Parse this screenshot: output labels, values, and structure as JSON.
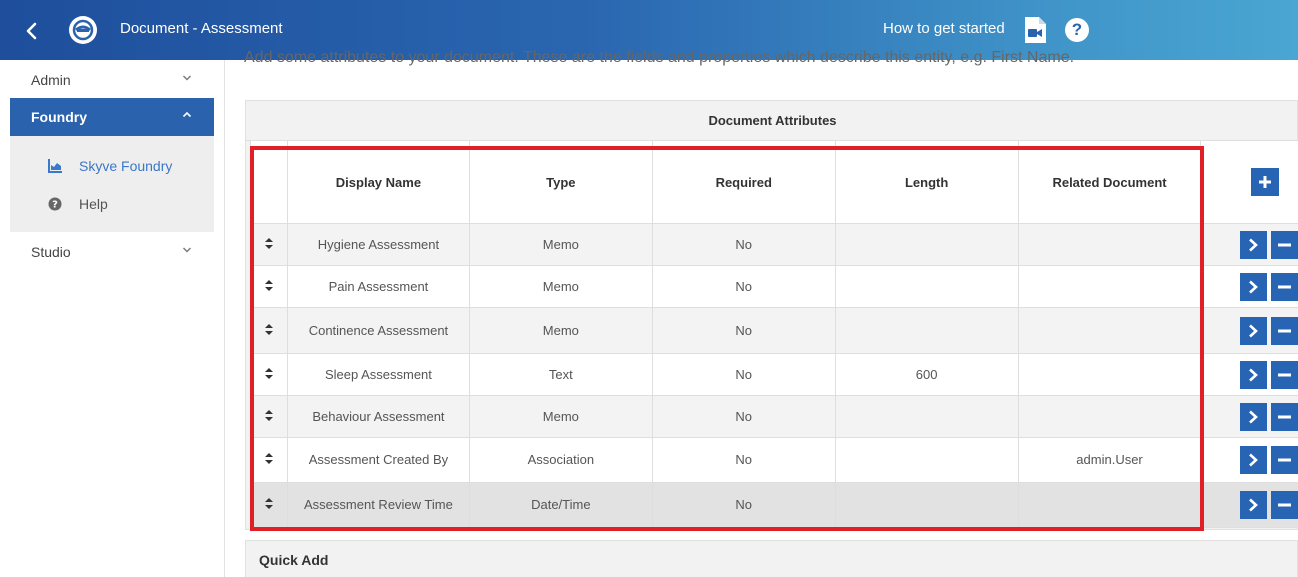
{
  "header": {
    "title": "Document - Assessment",
    "help_link": "How to get started"
  },
  "sidebar": {
    "groups": [
      {
        "label": "Admin"
      },
      {
        "label": "Foundry"
      },
      {
        "label": "Studio"
      }
    ],
    "foundry_items": [
      {
        "label": "Skyve Foundry",
        "icon": "chart-icon"
      },
      {
        "label": "Help",
        "icon": "question-circle-icon"
      }
    ]
  },
  "main": {
    "intro": "Add some attributes to your document. These are the fields and properties which describe this entity, e.g. First Name.",
    "panel_title": "Document Attributes",
    "columns": [
      "Display Name",
      "Type",
      "Required",
      "Length",
      "Related Document"
    ],
    "rows": [
      {
        "display_name": "Hygiene Assessment",
        "type": "Memo",
        "required": "No",
        "length": "",
        "related": ""
      },
      {
        "display_name": "Pain Assessment",
        "type": "Memo",
        "required": "No",
        "length": "",
        "related": ""
      },
      {
        "display_name": "Continence Assessment",
        "type": "Memo",
        "required": "No",
        "length": "",
        "related": ""
      },
      {
        "display_name": "Sleep Assessment",
        "type": "Text",
        "required": "No",
        "length": "600",
        "related": ""
      },
      {
        "display_name": "Behaviour Assessment",
        "type": "Memo",
        "required": "No",
        "length": "",
        "related": ""
      },
      {
        "display_name": "Assessment Created By",
        "type": "Association",
        "required": "No",
        "length": "",
        "related": "admin.User"
      },
      {
        "display_name": "Assessment Review Time",
        "type": "Date/Time",
        "required": "No",
        "length": "",
        "related": ""
      }
    ],
    "quick_add": "Quick Add"
  },
  "colors": {
    "accent": "#2764b3",
    "highlight": "#e11f27"
  }
}
